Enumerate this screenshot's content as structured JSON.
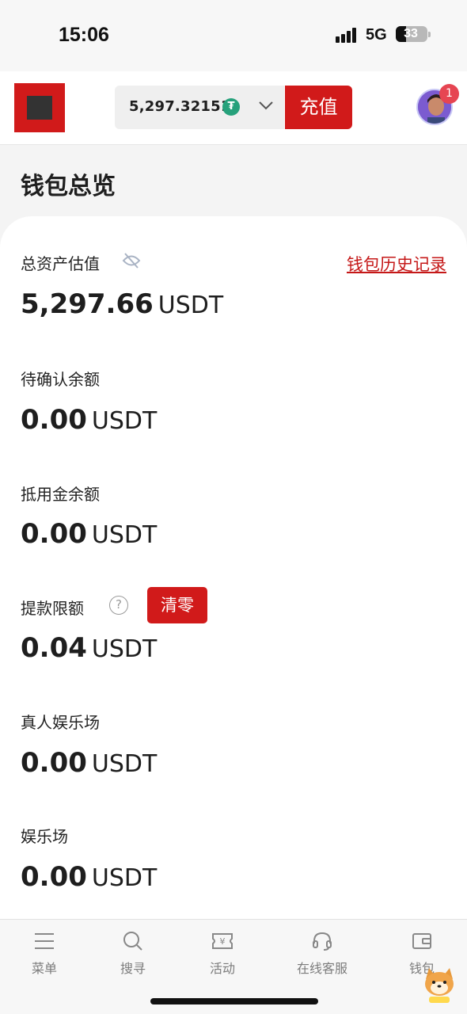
{
  "status_bar": {
    "time": "15:06",
    "network": "5G",
    "battery": "33"
  },
  "header": {
    "balance": "5,297.32151",
    "currency_icon": "tether-icon",
    "deposit_label": "充值",
    "notification_count": "1"
  },
  "page": {
    "title": "钱包总览"
  },
  "overview": {
    "total_label": "总资产估值",
    "history_link": "钱包历史记录",
    "rows": [
      {
        "label": "总资产估值",
        "amount": "5,297.66",
        "unit": "USDT"
      },
      {
        "label": "待确认余额",
        "amount": "0.00",
        "unit": "USDT"
      },
      {
        "label": "抵用金余额",
        "amount": "0.00",
        "unit": "USDT"
      },
      {
        "label": "提款限额",
        "amount": "0.04",
        "unit": "USDT"
      },
      {
        "label": "真人娱乐场",
        "amount": "0.00",
        "unit": "USDT"
      },
      {
        "label": "娱乐场",
        "amount": "0.00",
        "unit": "USDT"
      }
    ],
    "help_glyph": "?",
    "clear_label": "清零"
  },
  "nav": [
    {
      "label": "菜单",
      "icon": "menu-icon"
    },
    {
      "label": "搜寻",
      "icon": "search-icon"
    },
    {
      "label": "活动",
      "icon": "ticket-icon"
    },
    {
      "label": "在线客服",
      "icon": "headset-icon"
    },
    {
      "label": "钱包",
      "icon": "wallet-icon"
    }
  ],
  "colors": {
    "accent": "#d11a1a",
    "link": "#c51818",
    "badge": "#e64552",
    "tether": "#26a17b"
  }
}
